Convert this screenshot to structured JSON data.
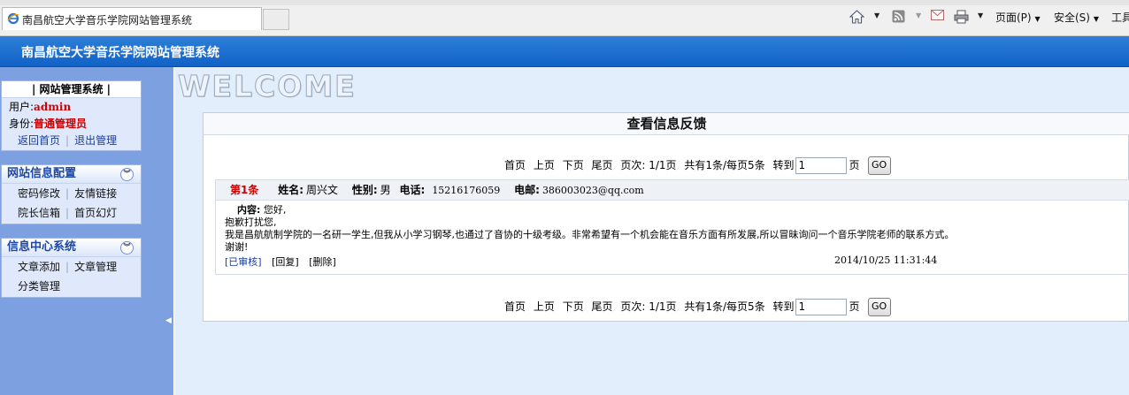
{
  "browser": {
    "tab_title": "南昌航空大学音乐学院网站管理系统",
    "toolbar": {
      "page_menu": "页面(P)",
      "safety_menu": "安全(S)",
      "tools_menu": "工具"
    },
    "icons": [
      "home-icon",
      "feed-icon",
      "mail-icon",
      "print-icon"
    ]
  },
  "header": {
    "title": "南昌航空大学音乐学院网站管理系统"
  },
  "sidebar": {
    "account": {
      "heading": "| 网站管理系统 |",
      "user_label": "用户:",
      "user_value": "admin",
      "role_label": "身份:",
      "role_value": "普通管理员",
      "home_link": "返回首页",
      "logout_link": "退出管理"
    },
    "site_config": {
      "heading": "网站信息配置",
      "items": [
        "密码修改",
        "友情链接",
        "院长信箱",
        "首页幻灯"
      ]
    },
    "info_center": {
      "heading": "信息中心系统",
      "items": [
        "文章添加",
        "文章管理",
        "分类管理"
      ]
    }
  },
  "main": {
    "welcome": "WELCOME",
    "panel_title": "查看信息反馈",
    "pager": {
      "first": "首页",
      "prev": "上页",
      "next": "下页",
      "last": "尾页",
      "pages": "页次: 1/1页",
      "total": "共有1条/每页5条",
      "goto_label": "转到",
      "goto_value": "1",
      "page_unit": "页",
      "go": "GO"
    },
    "record": {
      "number": "第1条",
      "name_label": "姓名:",
      "name_value": "周兴文",
      "gender_label": "性别:",
      "gender_value": "男",
      "phone_label": "电话:",
      "phone_value": "15216176059",
      "email_label": "电邮:",
      "email_value": "386003023@qq.com",
      "content_label": "内容:",
      "content_lines": [
        "您好,",
        "抱歉打扰您,",
        "我是昌航航制学院的一名研一学生,但我从小学习钢琴,也通过了音协的十级考级。非常希望有一个机会能在音乐方面有所发展,所以冒昧询问一个音乐学院老师的联系方式。",
        "谢谢!"
      ],
      "actions": [
        "[已审核]",
        "[回复]",
        "[删除]"
      ],
      "time": "2014/10/25 11:31:44"
    }
  }
}
